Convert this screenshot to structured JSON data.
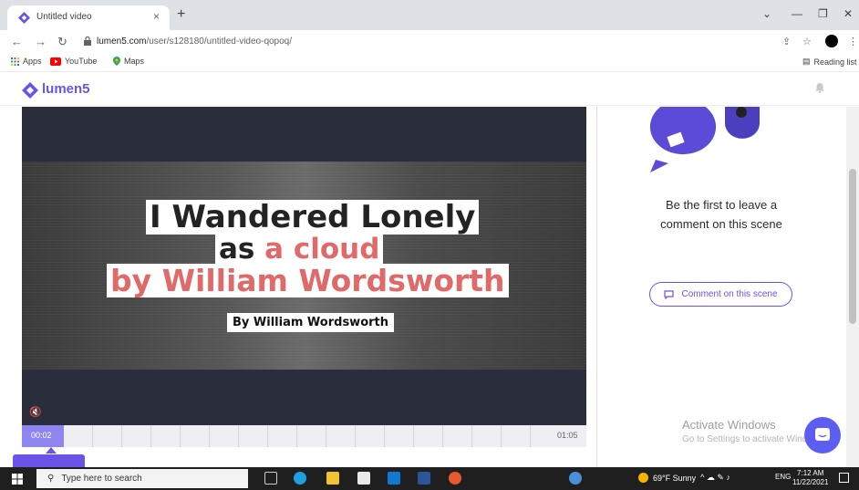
{
  "browser": {
    "tab_title": "Untitled video",
    "tab_close": "×",
    "new_tab": "+",
    "url_host": "lumen5.com",
    "url_path": "/user/s128180/untitled-video-qopoq/",
    "bookmarks": [
      {
        "label": "Apps",
        "icon": "apps-grid-icon"
      },
      {
        "label": "YouTube",
        "icon": "youtube-icon"
      },
      {
        "label": "Maps",
        "icon": "maps-pin-icon"
      }
    ],
    "reading_list": "Reading list"
  },
  "app": {
    "logo": "lumen5",
    "brand_color": "#6b53e8"
  },
  "scene": {
    "line1": "I Wandered Lonely",
    "line2_a": "as ",
    "line2_b": "a cloud",
    "line3": "by William Wordsworth",
    "byline": "By William Wordsworth",
    "accent_color": "#e06a6a"
  },
  "timeline": {
    "current": "00:02",
    "end": "01:05"
  },
  "side_panel": {
    "message_line1": "Be the first to leave a",
    "message_line2": "comment on this scene",
    "comment_button": "Comment on this scene"
  },
  "watermark": {
    "line1": "Activate Windows",
    "line2": "Go to Settings to activate Windows."
  },
  "taskbar": {
    "search_placeholder": "Type here to search",
    "weather": "69°F  Sunny",
    "lang": "ENG",
    "time": "7:12 AM",
    "date": "11/22/2021"
  }
}
